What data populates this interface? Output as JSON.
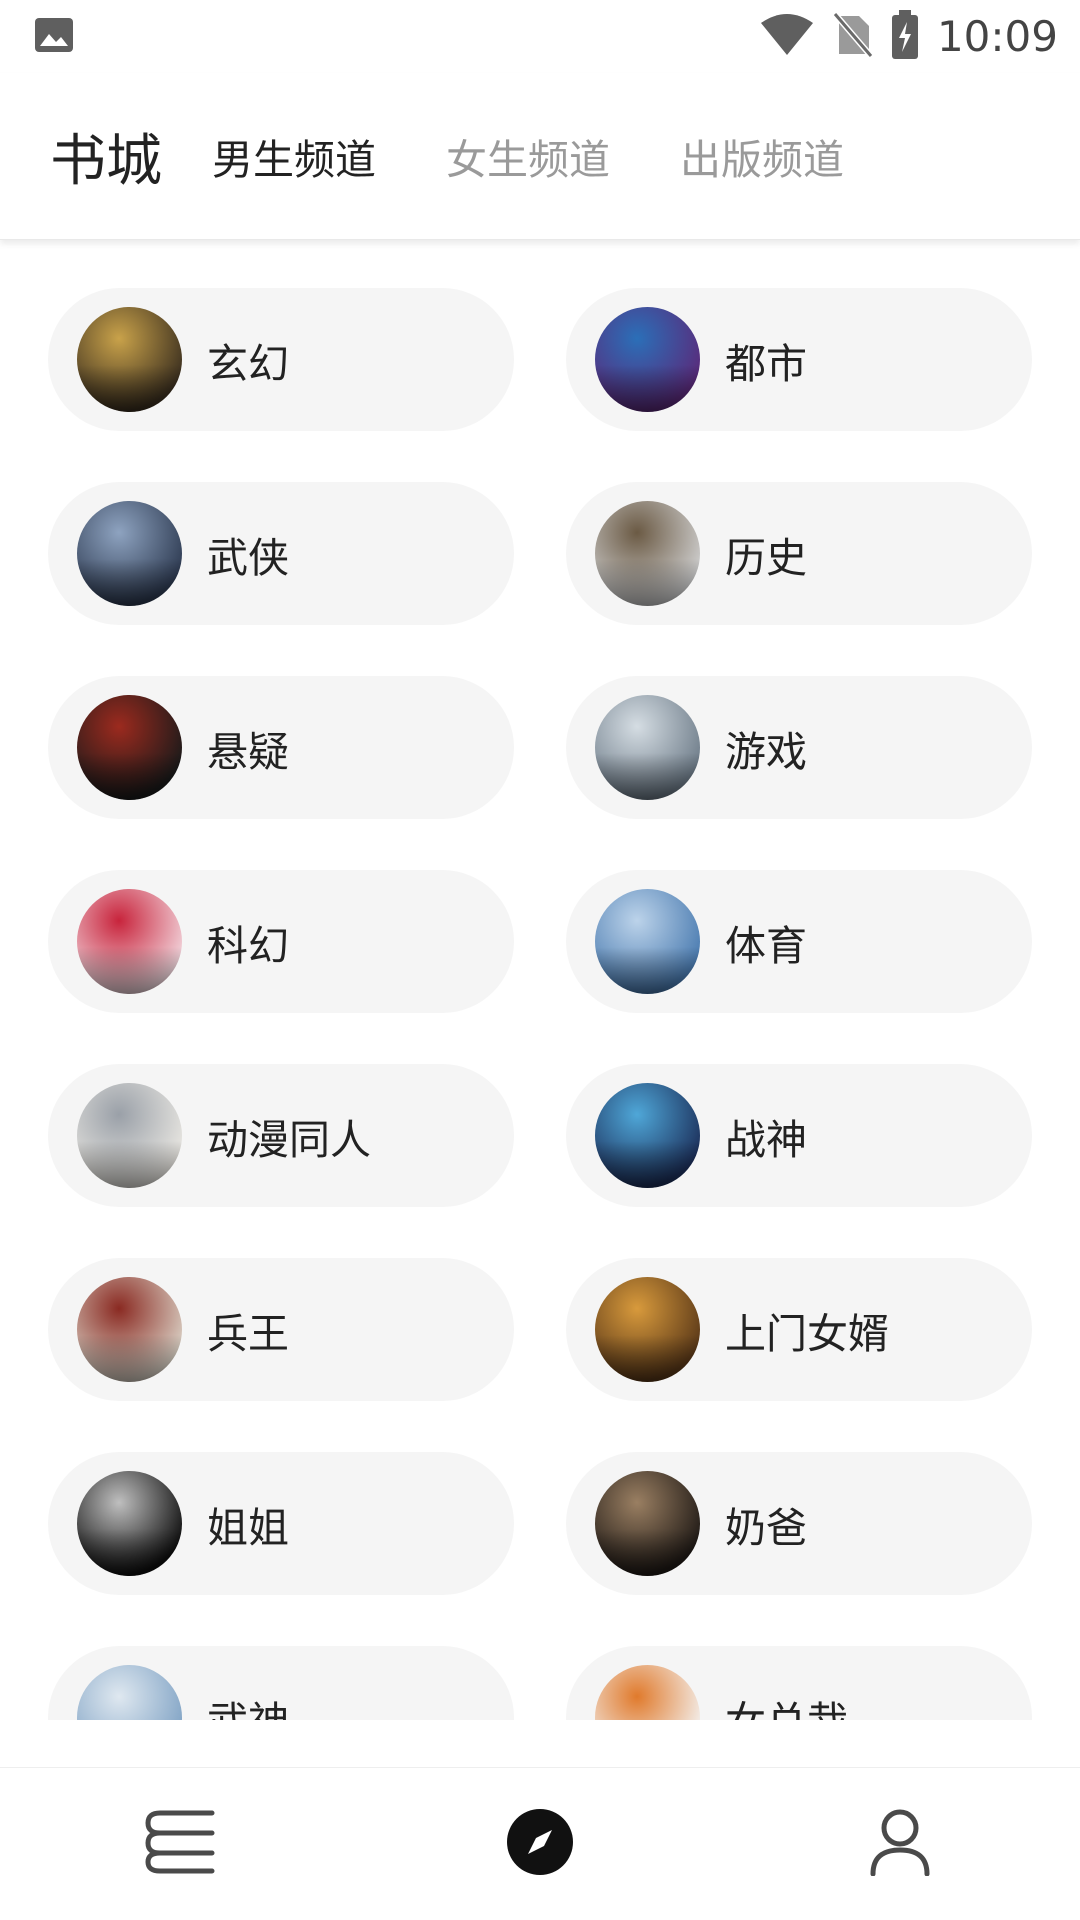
{
  "status_bar": {
    "time": "10:09",
    "icons": [
      "image-icon",
      "wifi-icon",
      "no-sim-icon",
      "battery-charging-icon"
    ]
  },
  "header": {
    "title": "书城",
    "tabs": [
      {
        "label": "男生频道",
        "active": true
      },
      {
        "label": "女生频道",
        "active": false
      },
      {
        "label": "出版频道",
        "active": false
      }
    ]
  },
  "categories": [
    {
      "label": "玄幻",
      "cover_colors": [
        "#3b2f1f",
        "#c9a24a"
      ]
    },
    {
      "label": "都市",
      "cover_colors": [
        "#5a2a7a",
        "#2b6fb8"
      ]
    },
    {
      "label": "武侠",
      "cover_colors": [
        "#2e3b52",
        "#8ea3c0"
      ]
    },
    {
      "label": "历史",
      "cover_colors": [
        "#cfcfcf",
        "#6b5a44"
      ]
    },
    {
      "label": "悬疑",
      "cover_colors": [
        "#1a1a1a",
        "#9c2a1e"
      ]
    },
    {
      "label": "游戏",
      "cover_colors": [
        "#6f7d8a",
        "#d5dde3"
      ]
    },
    {
      "label": "科幻",
      "cover_colors": [
        "#f2d5dc",
        "#c8243c"
      ]
    },
    {
      "label": "体育",
      "cover_colors": [
        "#4a7bb0",
        "#bcd3ea"
      ]
    },
    {
      "label": "动漫同人",
      "cover_colors": [
        "#e8e6e1",
        "#9aa0a8"
      ]
    },
    {
      "label": "战神",
      "cover_colors": [
        "#1c2f5a",
        "#4fa7d8"
      ]
    },
    {
      "label": "兵王",
      "cover_colors": [
        "#d9cfc3",
        "#8a2a22"
      ]
    },
    {
      "label": "上门女婿",
      "cover_colors": [
        "#5a3818",
        "#d89a3c"
      ]
    },
    {
      "label": "姐姐",
      "cover_colors": [
        "#0f0f0f",
        "#bfbfbf"
      ]
    },
    {
      "label": "奶爸",
      "cover_colors": [
        "#201a16",
        "#9a7f62"
      ]
    },
    {
      "label": "武神",
      "cover_colors": [
        "#7fa2c4",
        "#dfe8f0"
      ]
    },
    {
      "label": "女总裁",
      "cover_colors": [
        "#f4f4f4",
        "#e07a2c"
      ]
    }
  ],
  "bottom_nav": [
    {
      "icon": "bookshelf-icon",
      "active": false
    },
    {
      "icon": "discover-compass-icon",
      "active": true
    },
    {
      "icon": "profile-icon",
      "active": false
    }
  ]
}
